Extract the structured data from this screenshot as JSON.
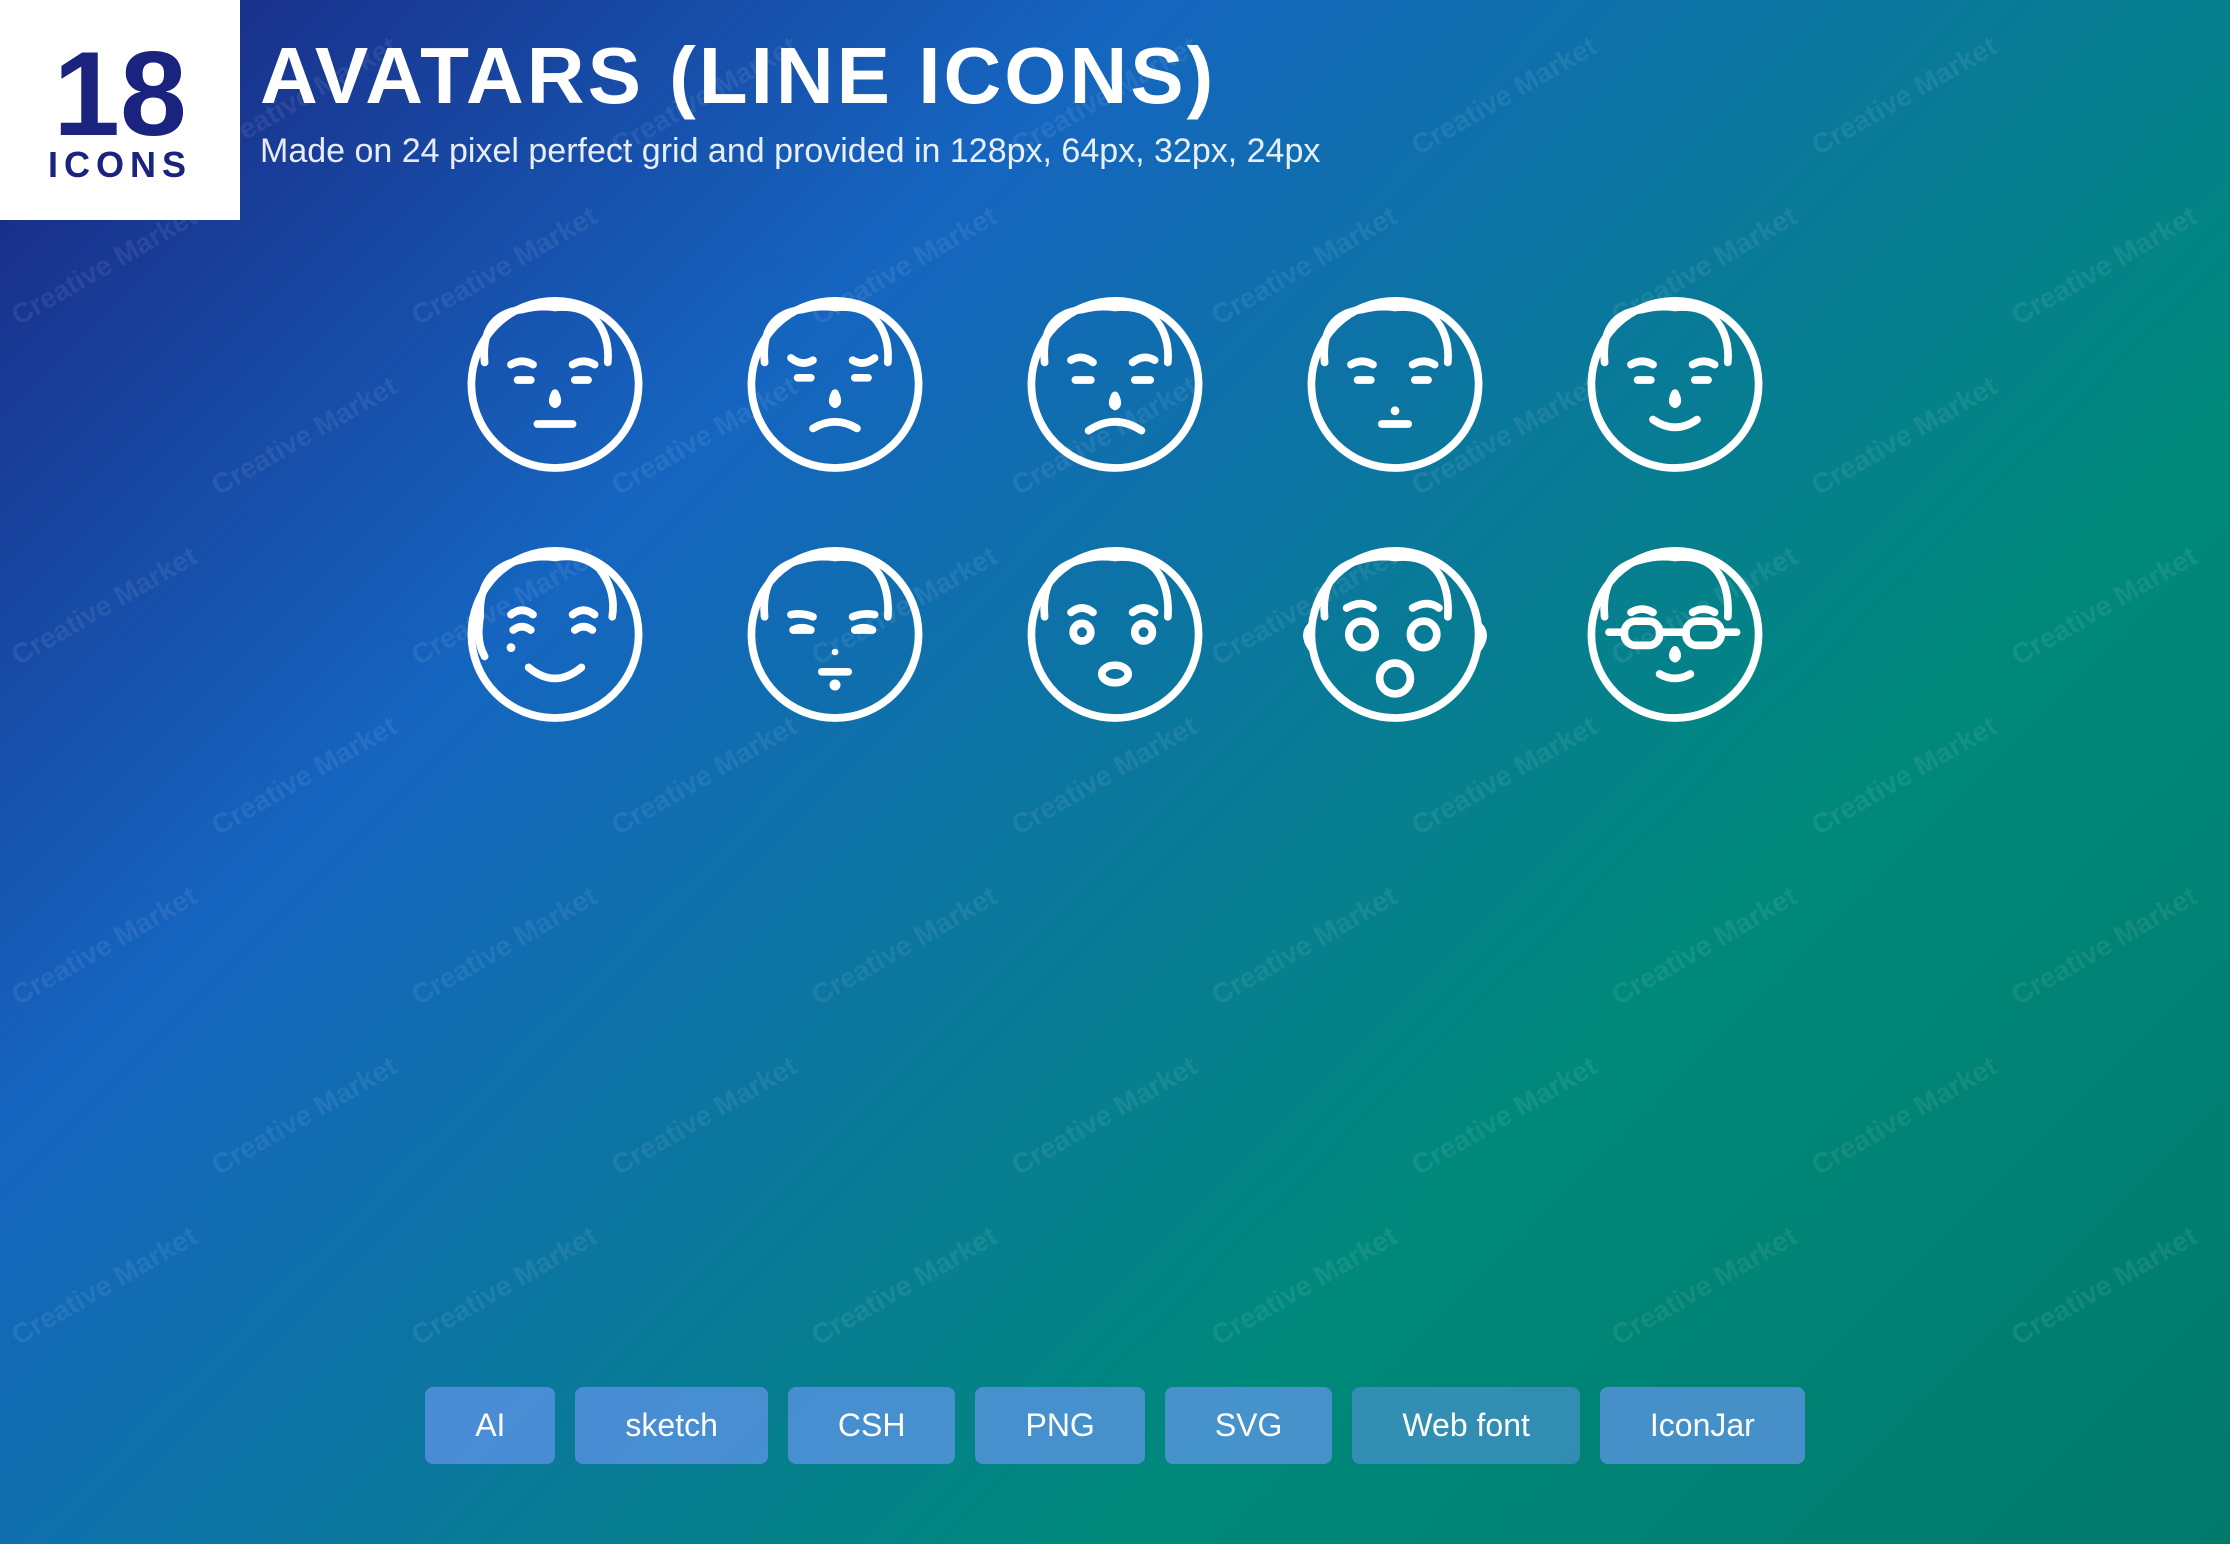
{
  "badge": {
    "number": "18",
    "label": "ICONS"
  },
  "header": {
    "title": "AVATARS (LINE ICONS)",
    "subtitle": "Made on 24 pixel perfect grid and provided in 128px, 64px, 32px, 24px"
  },
  "watermarks": [
    "Creative Market",
    "Creative Market",
    "Creative Market",
    "Creative Market"
  ],
  "format_badges": [
    {
      "label": "AI",
      "style": "blue"
    },
    {
      "label": "sketch",
      "style": "blue"
    },
    {
      "label": "CSH",
      "style": "blue"
    },
    {
      "label": "PNG",
      "style": "blue"
    },
    {
      "label": "SVG",
      "style": "blue"
    },
    {
      "label": "Web font",
      "style": "teal"
    },
    {
      "label": "IconJar",
      "style": "blue"
    }
  ],
  "icons": {
    "row1": [
      {
        "name": "avatar-neutral",
        "desc": "Neutral face"
      },
      {
        "name": "avatar-sad",
        "desc": "Sad face"
      },
      {
        "name": "avatar-frown",
        "desc": "Frowning face"
      },
      {
        "name": "avatar-smile-small",
        "desc": "Slight smile face"
      },
      {
        "name": "avatar-smile",
        "desc": "Smiling face"
      }
    ],
    "row2": [
      {
        "name": "avatar-happy",
        "desc": "Happy face"
      },
      {
        "name": "avatar-sleepy",
        "desc": "Sleepy face"
      },
      {
        "name": "avatar-surprised",
        "desc": "Surprised face"
      },
      {
        "name": "avatar-shocked",
        "desc": "Shocked face"
      },
      {
        "name": "avatar-glasses",
        "desc": "Glasses face"
      }
    ]
  }
}
